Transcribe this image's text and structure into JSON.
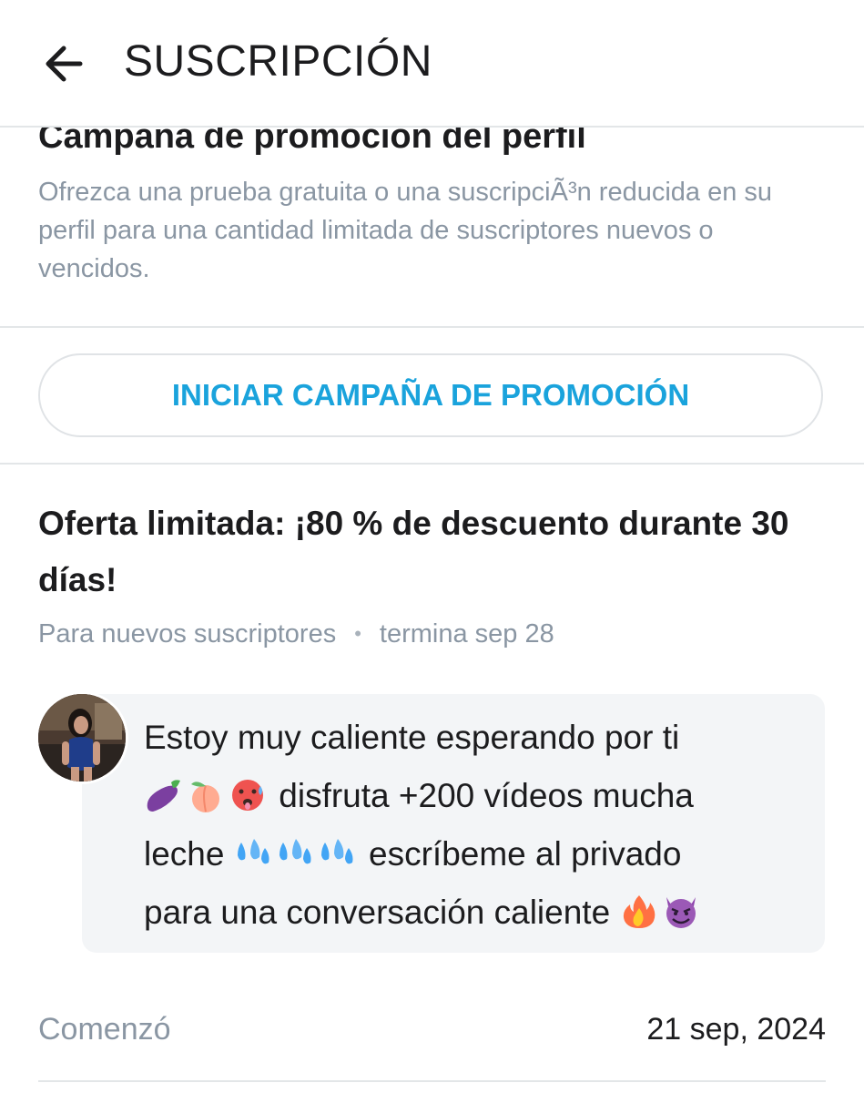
{
  "header": {
    "title": "SUSCRIPCIÓN",
    "back_icon": "arrow-left-icon"
  },
  "promo_campaign": {
    "title": "Campaña de promoción del perfil",
    "description": "Ofrezca una prueba gratuita o una suscripciÃ³n reducida en su perfil para una cantidad limitada de suscriptores nuevos o vencidos.",
    "button_label": "INICIAR CAMPAÑA DE PROMOCIÓN"
  },
  "offer": {
    "title": "Oferta limitada: ¡80 % de descuento durante 30 días!",
    "audience": "Para nuevos suscriptores",
    "separator": "•",
    "ends": "termina sep 28"
  },
  "message": {
    "line1": "Estoy muy caliente esperando por ti",
    "line2_text": "disfruta +200 vídeos mucha",
    "line3_prefix": "leche",
    "line3_suffix": "escríbeme al privado",
    "line4_text": "para una conversación caliente",
    "emojis": [
      "eggplant",
      "peach",
      "hot-face",
      "sweat-droplets",
      "fire",
      "smiling-imp"
    ]
  },
  "started": {
    "label": "Comenzó",
    "value": "21 sep, 2024"
  },
  "colors": {
    "accent": "#1aa3dc",
    "muted_text": "#8a96a3",
    "divider": "#e3e6e8",
    "bubble_bg": "#f3f5f7"
  }
}
